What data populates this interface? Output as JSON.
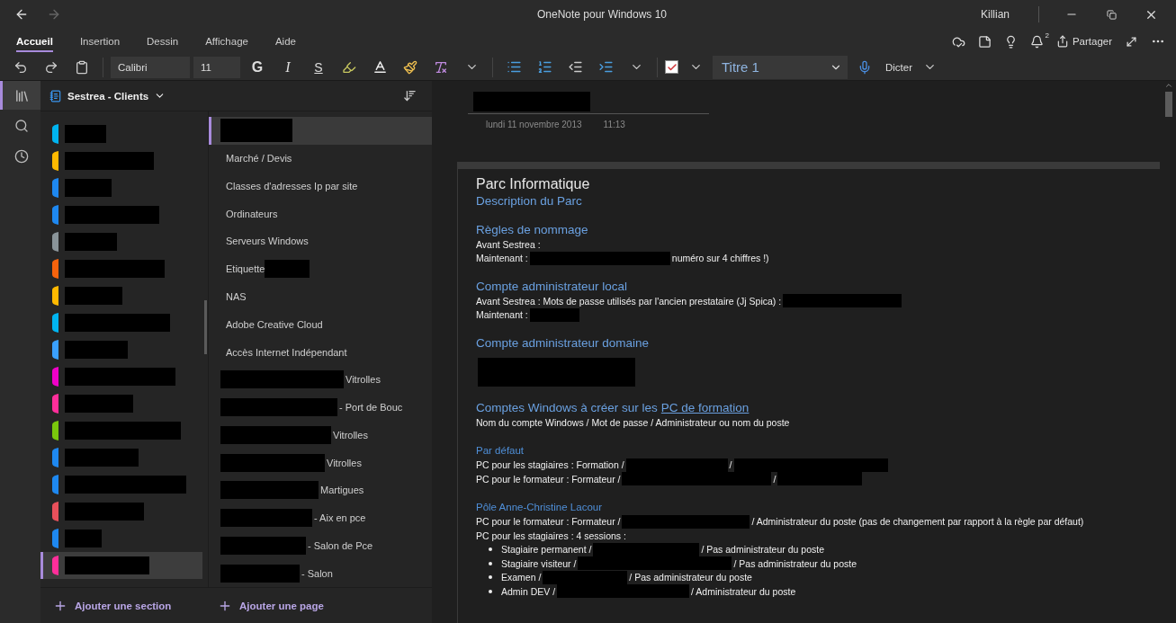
{
  "window": {
    "title": "OneNote pour Windows 10",
    "user": "Killian"
  },
  "ribbon_tabs": [
    {
      "label": "Accueil",
      "selected": true
    },
    {
      "label": "Insertion",
      "selected": false
    },
    {
      "label": "Dessin",
      "selected": false
    },
    {
      "label": "Affichage",
      "selected": false
    },
    {
      "label": "Aide",
      "selected": false
    }
  ],
  "notifications": {
    "count": "2"
  },
  "share": {
    "label": "Partager"
  },
  "toolbar": {
    "font": "Calibri",
    "size": "11",
    "bold": "G",
    "italic": "I",
    "underline": "S",
    "style": "Titre 1",
    "dictate": "Dicter",
    "todo_checked": true
  },
  "notebook": {
    "name": "Sestrea - Clients"
  },
  "sections": [
    {
      "color": "#00b4f0",
      "selected": false
    },
    {
      "color": "#ffb900",
      "selected": false
    },
    {
      "color": "#1e88f0",
      "selected": false
    },
    {
      "color": "#1e88f0",
      "selected": false
    },
    {
      "color": "#8a9499",
      "selected": false
    },
    {
      "color": "#f7630c",
      "selected": false
    },
    {
      "color": "#ffb900",
      "selected": false
    },
    {
      "color": "#00b4f0",
      "selected": false
    },
    {
      "color": "#3aa0ff",
      "selected": false
    },
    {
      "color": "#f000c8",
      "selected": false
    },
    {
      "color": "#ff2e9a",
      "selected": false
    },
    {
      "color": "#7ac70c",
      "selected": false
    },
    {
      "color": "#1e88f0",
      "selected": false
    },
    {
      "color": "#1e88f0",
      "selected": false
    },
    {
      "color": "#e8505b",
      "selected": false
    },
    {
      "color": "#1e88f0",
      "selected": false
    },
    {
      "color": "#ff2e9a",
      "selected": true
    }
  ],
  "add_section": "Ajouter une section",
  "pages": [
    {
      "selected": true,
      "parts": [
        {
          "kind": "redacted"
        }
      ]
    },
    {
      "selected": false,
      "parts": [
        {
          "kind": "text",
          "text": "Marché / Devis"
        }
      ]
    },
    {
      "selected": false,
      "parts": [
        {
          "kind": "text",
          "text": "Classes d'adresses Ip par site"
        }
      ]
    },
    {
      "selected": false,
      "parts": [
        {
          "kind": "text",
          "text": "Ordinateurs"
        }
      ]
    },
    {
      "selected": false,
      "parts": [
        {
          "kind": "text",
          "text": "Serveurs Windows"
        }
      ]
    },
    {
      "selected": false,
      "parts": [
        {
          "kind": "text",
          "text": "Etiquette"
        },
        {
          "kind": "redacted"
        }
      ]
    },
    {
      "selected": false,
      "parts": [
        {
          "kind": "text",
          "text": "NAS"
        }
      ]
    },
    {
      "selected": false,
      "parts": [
        {
          "kind": "text",
          "text": "Adobe Creative Cloud"
        }
      ]
    },
    {
      "selected": false,
      "parts": [
        {
          "kind": "text",
          "text": "Accès Internet Indépendant"
        }
      ]
    },
    {
      "selected": false,
      "parts": [
        {
          "kind": "redacted"
        },
        {
          "kind": "text",
          "text": "Vitrolles"
        }
      ]
    },
    {
      "selected": false,
      "parts": [
        {
          "kind": "redacted"
        },
        {
          "kind": "text",
          "text": "- Port de Bouc"
        }
      ]
    },
    {
      "selected": false,
      "parts": [
        {
          "kind": "redacted"
        },
        {
          "kind": "text",
          "text": "Vitrolles"
        }
      ]
    },
    {
      "selected": false,
      "parts": [
        {
          "kind": "redacted"
        },
        {
          "kind": "text",
          "text": "Vitrolles"
        }
      ]
    },
    {
      "selected": false,
      "parts": [
        {
          "kind": "redacted"
        },
        {
          "kind": "text",
          "text": "Martigues"
        }
      ]
    },
    {
      "selected": false,
      "parts": [
        {
          "kind": "redacted"
        },
        {
          "kind": "text",
          "text": "- Aix en pce"
        }
      ]
    },
    {
      "selected": false,
      "parts": [
        {
          "kind": "redacted"
        },
        {
          "kind": "text",
          "text": "- Salon de Pce"
        }
      ]
    },
    {
      "selected": false,
      "parts": [
        {
          "kind": "redacted"
        },
        {
          "kind": "text",
          "text": "- Salon"
        }
      ]
    }
  ],
  "add_page": "Ajouter une page",
  "note": {
    "date": "lundi 11 novembre 2013",
    "time": "11:13",
    "blocks": [
      {
        "kind": "title",
        "parts": [
          {
            "kind": "text",
            "text": "Parc Informatique"
          }
        ]
      },
      {
        "kind": "subtitle",
        "parts": [
          {
            "kind": "text",
            "text": "Description du Parc"
          }
        ]
      },
      {
        "kind": "heading",
        "parts": [
          {
            "kind": "text",
            "text": "Règles de nommage"
          }
        ]
      },
      {
        "kind": "line",
        "parts": [
          {
            "kind": "text",
            "text": "Avant Sestrea :"
          }
        ]
      },
      {
        "kind": "line",
        "parts": [
          {
            "kind": "text",
            "text": "Maintenant :"
          },
          {
            "kind": "redacted"
          },
          {
            "kind": "text",
            "text": "numéro sur 4 chiffres !)"
          }
        ]
      },
      {
        "kind": "heading",
        "parts": [
          {
            "kind": "text",
            "text": "Compte administrateur local"
          }
        ]
      },
      {
        "kind": "line",
        "parts": [
          {
            "kind": "text",
            "text": "Avant Sestrea : Mots de passe utilisés par l'ancien prestataire (Jj Spica) :"
          },
          {
            "kind": "redacted"
          }
        ]
      },
      {
        "kind": "line",
        "parts": [
          {
            "kind": "text",
            "text": "Maintenant :"
          },
          {
            "kind": "redacted"
          }
        ]
      },
      {
        "kind": "heading",
        "parts": [
          {
            "kind": "text",
            "text": "Compte administrateur domaine"
          }
        ]
      },
      {
        "kind": "block",
        "parts": [
          {
            "kind": "redacted"
          }
        ]
      },
      {
        "kind": "heading",
        "parts": [
          {
            "kind": "text",
            "text": "Comptes Windows à créer sur les "
          },
          {
            "kind": "link",
            "text": "PC de formation"
          }
        ]
      },
      {
        "kind": "line",
        "parts": [
          {
            "kind": "text",
            "text": "Nom du compte Windows / Mot de passe / Administrateur ou nom du poste"
          }
        ]
      },
      {
        "kind": "subheading",
        "parts": [
          {
            "kind": "text",
            "text": "Par défaut"
          }
        ]
      },
      {
        "kind": "line",
        "parts": [
          {
            "kind": "text",
            "text": "PC pour les stagiaires : Formation /"
          },
          {
            "kind": "redacted"
          },
          {
            "kind": "text",
            "text": "/"
          },
          {
            "kind": "redacted"
          }
        ]
      },
      {
        "kind": "line",
        "parts": [
          {
            "kind": "text",
            "text": "PC pour le formateur : Formateur /"
          },
          {
            "kind": "redacted"
          },
          {
            "kind": "text",
            "text": "/"
          },
          {
            "kind": "redacted"
          }
        ]
      },
      {
        "kind": "subheading",
        "parts": [
          {
            "kind": "text",
            "text": "Pôle Anne-Christine Lacour"
          }
        ]
      },
      {
        "kind": "line",
        "parts": [
          {
            "kind": "text",
            "text": "PC pour le formateur : Formateur /"
          },
          {
            "kind": "redacted"
          },
          {
            "kind": "text",
            "text": "/ Administrateur du poste (pas de changement par rapport à la règle par défaut)"
          }
        ]
      },
      {
        "kind": "line",
        "parts": [
          {
            "kind": "text",
            "text": "PC pour les stagiaires : 4 sessions :"
          }
        ]
      },
      {
        "kind": "bullet",
        "parts": [
          {
            "kind": "text",
            "text": "Stagiaire permanent /"
          },
          {
            "kind": "redacted"
          },
          {
            "kind": "text",
            "text": "/ Pas administrateur du poste"
          }
        ]
      },
      {
        "kind": "bullet",
        "parts": [
          {
            "kind": "text",
            "text": "Stagiaire visiteur /"
          },
          {
            "kind": "redacted"
          },
          {
            "kind": "text",
            "text": "/ Pas administrateur du poste"
          }
        ]
      },
      {
        "kind": "bullet",
        "parts": [
          {
            "kind": "text",
            "text": "Examen /"
          },
          {
            "kind": "redacted"
          },
          {
            "kind": "text",
            "text": "/ Pas administrateur du poste"
          }
        ]
      },
      {
        "kind": "bullet",
        "parts": [
          {
            "kind": "text",
            "text": "Admin DEV /"
          },
          {
            "kind": "redacted"
          },
          {
            "kind": "text",
            "text": "/ Administrateur du poste"
          }
        ]
      }
    ]
  }
}
